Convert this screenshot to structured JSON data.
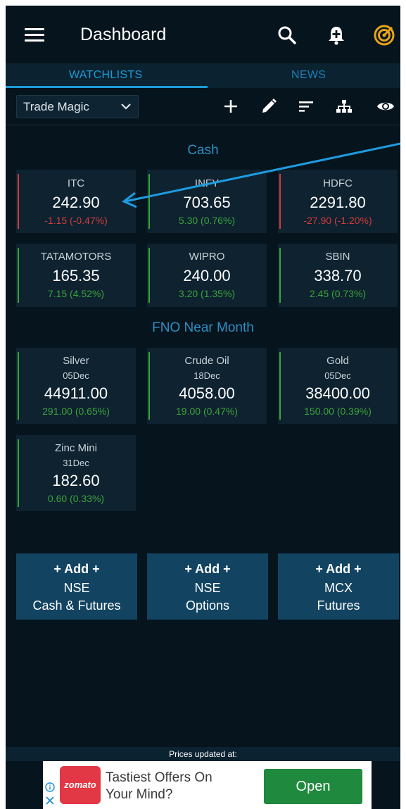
{
  "header": {
    "title": "Dashboard"
  },
  "tabs": [
    {
      "label": "WATCHLISTS",
      "active": true
    },
    {
      "label": "NEWS",
      "active": false
    }
  ],
  "watchlist": {
    "selected": "Trade Magic"
  },
  "toolbar_icons": [
    "plus-icon",
    "pencil-icon",
    "sort-icon",
    "hierarchy-icon",
    "eye-icon"
  ],
  "sections": {
    "cash": "Cash",
    "fno": "FNO Near Month"
  },
  "cash": [
    {
      "name": "ITC",
      "price": "242.90",
      "change": "-1.15 (-0.47%)",
      "dir": "down"
    },
    {
      "name": "INFY",
      "price": "703.65",
      "change": "5.30 (0.76%)",
      "dir": "up"
    },
    {
      "name": "HDFC",
      "price": "2291.80",
      "change": "-27.90 (-1.20%)",
      "dir": "down"
    },
    {
      "name": "TATAMOTORS",
      "price": "165.35",
      "change": "7.15 (4.52%)",
      "dir": "up"
    },
    {
      "name": "WIPRO",
      "price": "240.00",
      "change": "3.20 (1.35%)",
      "dir": "up"
    },
    {
      "name": "SBIN",
      "price": "338.70",
      "change": "2.45 (0.73%)",
      "dir": "up"
    }
  ],
  "fno": [
    {
      "name": "Silver",
      "expiry": "05Dec",
      "price": "44911.00",
      "change": "291.00 (0.65%)",
      "dir": "up"
    },
    {
      "name": "Crude Oil",
      "expiry": "18Dec",
      "price": "4058.00",
      "change": "19.00 (0.47%)",
      "dir": "up"
    },
    {
      "name": "Gold",
      "expiry": "05Dec",
      "price": "38400.00",
      "change": "150.00 (0.39%)",
      "dir": "up"
    },
    {
      "name": "Zinc Mini",
      "expiry": "31Dec",
      "price": "182.60",
      "change": "0.60 (0.33%)",
      "dir": "up"
    }
  ],
  "add_buttons": [
    {
      "line1": "+ Add +",
      "line2": "NSE",
      "line3": "Cash & Futures"
    },
    {
      "line1": "+ Add +",
      "line2": "NSE",
      "line3": "Options"
    },
    {
      "line1": "+ Add +",
      "line2": "MCX",
      "line3": "Futures"
    }
  ],
  "footer": {
    "updated_label": "Prices updated at:"
  },
  "ad": {
    "brand": "zomato",
    "text": "Tastiest Offers On Your Mind?",
    "button": "Open"
  },
  "colors": {
    "bg": "#06141d",
    "card": "#0e2230",
    "accent": "#1e9bd6",
    "up": "#3aa33a",
    "down": "#d23c3c",
    "add_btn": "#124462",
    "gold": "#e8a417"
  }
}
